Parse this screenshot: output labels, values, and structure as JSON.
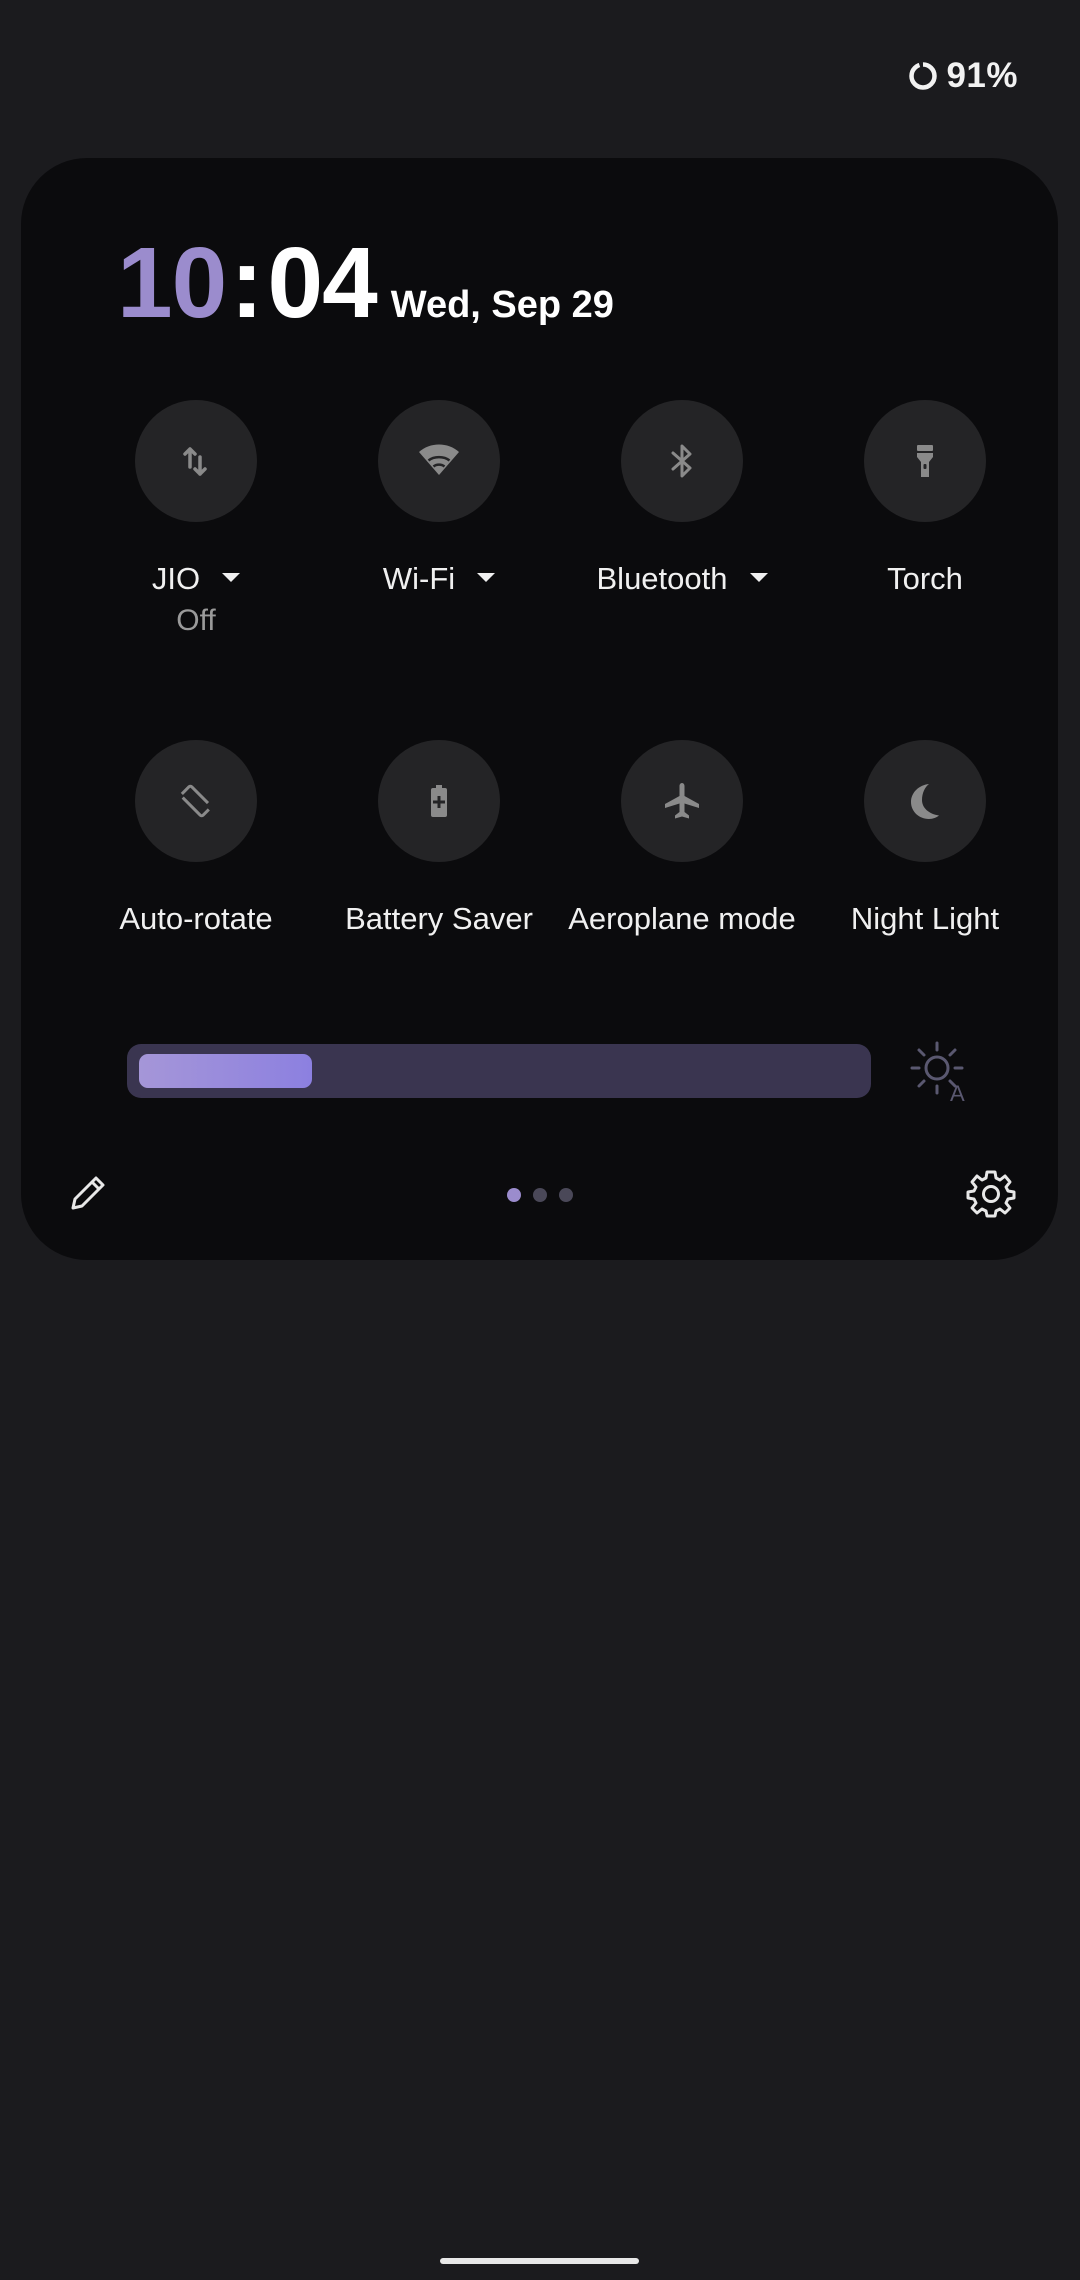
{
  "status_bar": {
    "battery_percent": "91%",
    "battery_icon": "battery-ring-icon"
  },
  "clock": {
    "hour": "10",
    "colon": ":",
    "minute": "04",
    "date": "Wed, Sep 29"
  },
  "tiles": [
    {
      "id": "mobile-data",
      "icon": "mobile-data-icon",
      "label": "JIO",
      "sublabel": "Off",
      "has_dropdown": true
    },
    {
      "id": "wifi",
      "icon": "wifi-icon",
      "label": "Wi-Fi",
      "has_dropdown": true
    },
    {
      "id": "bluetooth",
      "icon": "bluetooth-icon",
      "label": "Bluetooth",
      "has_dropdown": true
    },
    {
      "id": "torch",
      "icon": "torch-icon",
      "label": "Torch",
      "has_dropdown": false
    },
    {
      "id": "auto-rotate",
      "icon": "auto-rotate-icon",
      "label": "Auto-rotate",
      "has_dropdown": false
    },
    {
      "id": "battery-saver",
      "icon": "battery-saver-icon",
      "label": "Battery Saver",
      "has_dropdown": false
    },
    {
      "id": "aeroplane-mode",
      "icon": "aeroplane-icon",
      "label": "Aeroplane mode",
      "has_dropdown": false
    },
    {
      "id": "night-light",
      "icon": "moon-icon",
      "label": "Night Light",
      "has_dropdown": false
    }
  ],
  "brightness": {
    "level_fraction": 0.24,
    "auto_icon": "auto-brightness-icon"
  },
  "footer": {
    "edit_icon": "pencil-icon",
    "settings_icon": "gear-icon",
    "pages_total": 3,
    "page_current": 1
  },
  "colors": {
    "accent": "#9b8ccd",
    "panel_bg": "#0b0b0d",
    "screen_bg": "#1b1b1e",
    "tile_bg": "#242426",
    "icon_inactive": "#8a8a8a"
  }
}
